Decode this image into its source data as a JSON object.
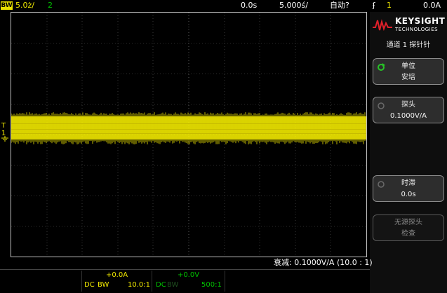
{
  "topbar": {
    "bw_badge": "BW",
    "ch1_scale": "5.0ż/",
    "ch2_label": "2",
    "time_delay": "0.0s",
    "time_scale": "5.000ś/",
    "trigger_mode": "自动?",
    "trigger_icon": "ʄ",
    "trigger_source": "1",
    "trigger_level": "0.0A"
  },
  "colors": {
    "ch1": "#f0e800",
    "ch2": "#00c000",
    "grid": "#5a5a5a"
  },
  "logo": {
    "brand": "KEYSIGHT",
    "sub": "TECHNOLOGIES"
  },
  "menu": {
    "title": "通道 1 探针针",
    "softkeys": [
      {
        "label": "单位",
        "value": "安培",
        "enabled": true
      },
      {
        "label": "探头",
        "value": "0.1000V/A",
        "enabled": true
      },
      {
        "label": "时滞",
        "value": "0.0s",
        "enabled": true
      },
      {
        "label": "无源探头",
        "value": "检查",
        "enabled": false
      }
    ]
  },
  "status": {
    "attenuation": "衰减: 0.1000V/A (10.0 : 1)"
  },
  "ch1_info": {
    "offset": "+0.0A",
    "coupling": "DC",
    "bw": "BW",
    "ratio": "10.0:1"
  },
  "ch2_info": {
    "offset": "+0.0V",
    "coupling": "DC",
    "bw": "BW",
    "ratio": "500:1"
  },
  "markers": {
    "ch1_marker": "1",
    "trigger_marker": "T"
  }
}
